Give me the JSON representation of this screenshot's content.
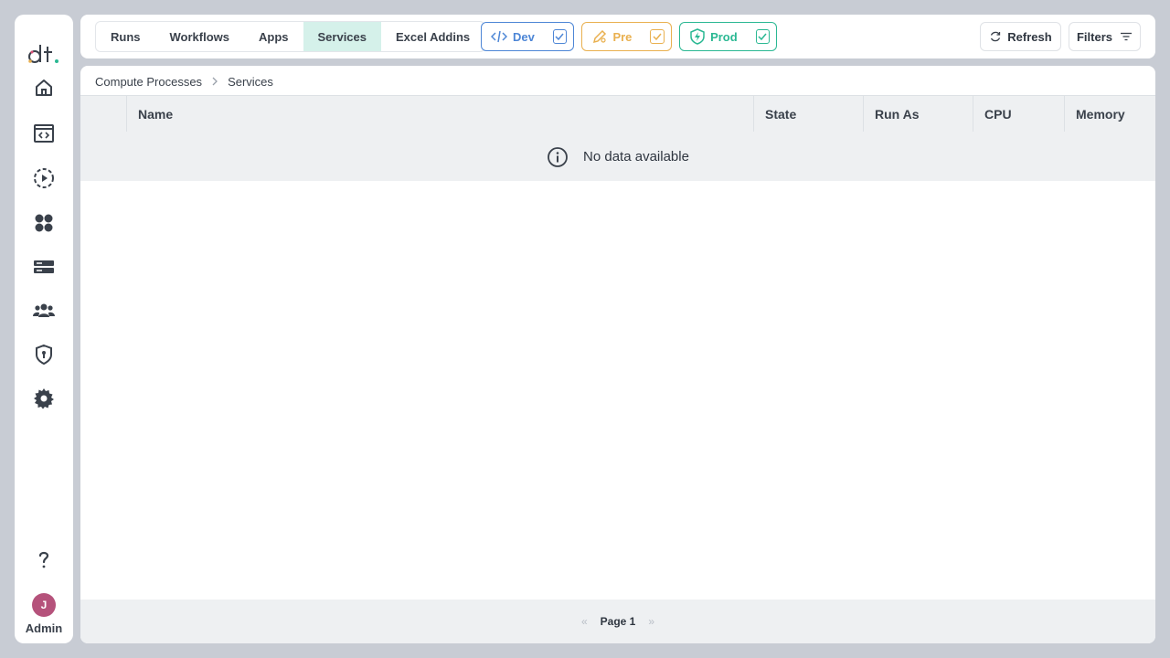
{
  "sidebar": {
    "logo": "dt.",
    "items": [
      {
        "name": "home",
        "icon": "home-icon"
      },
      {
        "name": "code-editor",
        "icon": "code-window-icon"
      },
      {
        "name": "runs",
        "icon": "play-circle-icon"
      },
      {
        "name": "apps",
        "icon": "apps-grid-icon"
      },
      {
        "name": "servers",
        "icon": "server-icon"
      },
      {
        "name": "users",
        "icon": "users-icon"
      },
      {
        "name": "security",
        "icon": "shield-lock-icon"
      },
      {
        "name": "settings",
        "icon": "gear-icon"
      }
    ],
    "help_icon": "question-icon",
    "user": {
      "initial": "J",
      "label": "Admin",
      "color": "#b5527b"
    }
  },
  "topbar": {
    "tabs": [
      "Runs",
      "Workflows",
      "Apps",
      "Services",
      "Excel Addins"
    ],
    "active_tab": "Services",
    "environments": [
      {
        "label": "Dev",
        "color": "#4d86d6",
        "checked": true
      },
      {
        "label": "Pre",
        "color": "#e9b04f",
        "checked": true
      },
      {
        "label": "Prod",
        "color": "#2bb893",
        "checked": true
      }
    ],
    "refresh_label": "Refresh",
    "filters_label": "Filters"
  },
  "breadcrumb": [
    "Compute Processes",
    "Services"
  ],
  "table": {
    "columns": [
      "Name",
      "State",
      "Run As",
      "CPU",
      "Memory"
    ],
    "empty_message": "No data available"
  },
  "pagination": {
    "label": "Page 1",
    "prev": "«",
    "next": "»"
  }
}
